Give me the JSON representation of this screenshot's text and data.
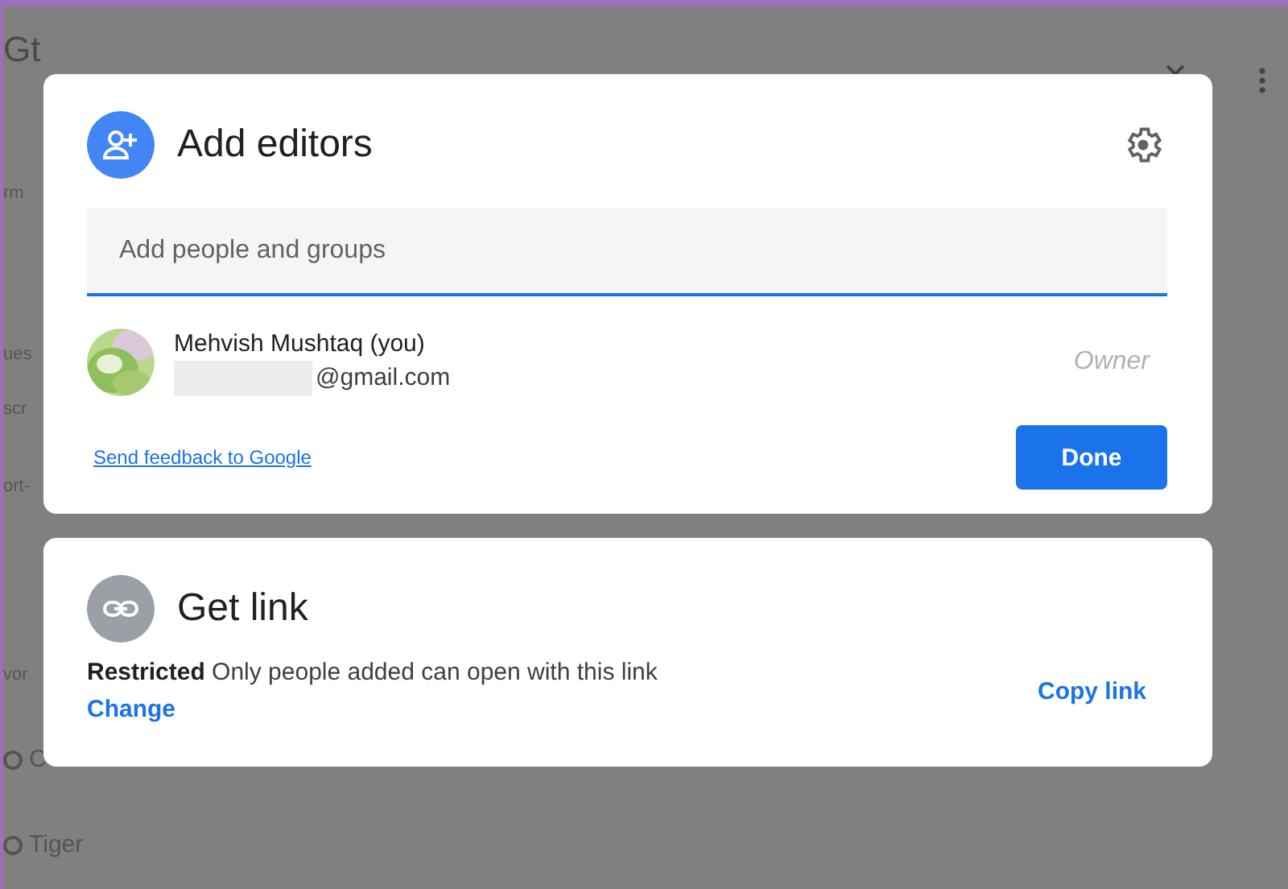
{
  "background": {
    "fragments": [
      {
        "kind": "title",
        "text": "Gt"
      },
      {
        "kind": "line",
        "text": "rm"
      },
      {
        "kind": "line",
        "text": "ues"
      },
      {
        "kind": "line",
        "text": "scr"
      },
      {
        "kind": "line",
        "text": "ort-"
      },
      {
        "kind": "line",
        "text": "vor"
      },
      {
        "kind": "option",
        "text": "C",
        "selected": false
      },
      {
        "kind": "option",
        "text": "Tiger",
        "selected": false
      }
    ]
  },
  "add_editors": {
    "title": "Add editors",
    "search": {
      "placeholder": "Add people and groups"
    },
    "people": [
      {
        "name": "Mehvish Mushtaq (you)",
        "email": "@gmail.com",
        "email_redacted": true,
        "role": "Owner"
      }
    ],
    "feedback_link": "Send feedback to Google",
    "done_button": "Done"
  },
  "get_link": {
    "title": "Get link",
    "description": "**Restricted** Only people added can open with this link",
    "change_link": "Change",
    "copy_button": "Copy link"
  }
}
